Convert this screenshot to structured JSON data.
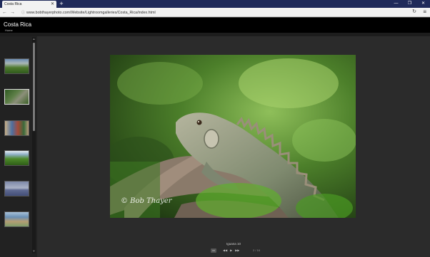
{
  "browser": {
    "tab_title": "Costa Rica",
    "tab_close": "✕",
    "new_tab": "+",
    "win_minimize": "—",
    "win_restore": "❐",
    "win_close": "✕",
    "back": "←",
    "forward": "→",
    "info_icon": "ⓘ",
    "url": "www.bobthayerphoto.com/Website/Lightroomgalleries/Costa_Rica/index.html",
    "reload": "↻",
    "menu": "≡"
  },
  "page": {
    "title": "Costa Rica",
    "home_link": "Home"
  },
  "sidebar": {
    "scroll_up": "▲",
    "scroll_down": "▼",
    "thumbnails": [
      "thumbnail-1",
      "thumbnail-2",
      "thumbnail-3",
      "thumbnail-4",
      "thumbnail-5",
      "thumbnail-6"
    ]
  },
  "viewer": {
    "watermark": "© Bob Thayer",
    "caption": "Iguana 10",
    "slideshow_icon": "▭",
    "prev": "◀◀",
    "play": "▶",
    "next": "▶▶",
    "counter": "2 / 16"
  }
}
